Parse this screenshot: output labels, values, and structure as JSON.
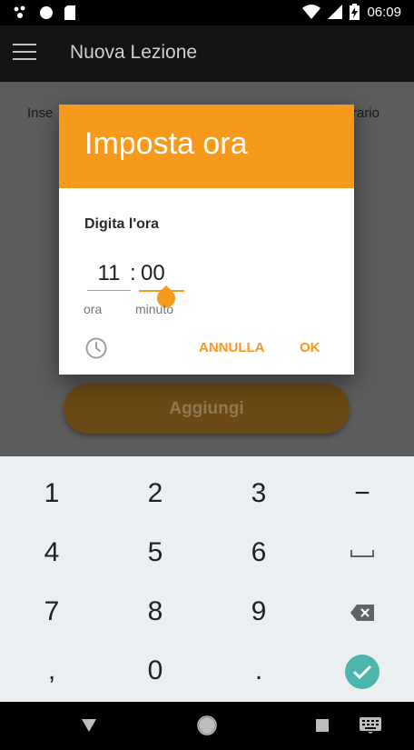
{
  "status_bar": {
    "time": "06:09",
    "icons": [
      "notification-dots-icon",
      "circle-icon",
      "sd-card-icon",
      "wifi-icon",
      "signal-icon",
      "battery-charging-icon"
    ]
  },
  "app_bar": {
    "title": "Nuova Lezione",
    "menu_icon": "hamburger-menu-icon"
  },
  "content": {
    "hint_left": "Inse",
    "hint_right": "rario",
    "add_button_label": "Aggiungi"
  },
  "dialog": {
    "title": "Imposta ora",
    "subtitle": "Digita l'ora",
    "hour_value": "11",
    "separator": ":",
    "minute_value": "00",
    "hour_label": "ora",
    "minute_label": "minuto",
    "clock_icon": "clock-icon",
    "cancel_label": "ANNULLA",
    "ok_label": "OK"
  },
  "keyboard": {
    "keys": [
      [
        "1",
        "2",
        "3",
        "−"
      ],
      [
        "4",
        "5",
        "6",
        "␣"
      ],
      [
        "7",
        "8",
        "9",
        "⌫"
      ],
      [
        ",",
        "0",
        ".",
        "✓"
      ]
    ]
  },
  "nav_bar": {
    "back_icon": "back-triangle-icon",
    "home_icon": "home-circle-icon",
    "recents_icon": "recents-square-icon",
    "keyboard_icon": "keyboard-icon"
  },
  "colors": {
    "accent": "#f7991a",
    "scrim": "#5c5c5c",
    "confirm_key": "#4db6ac"
  }
}
